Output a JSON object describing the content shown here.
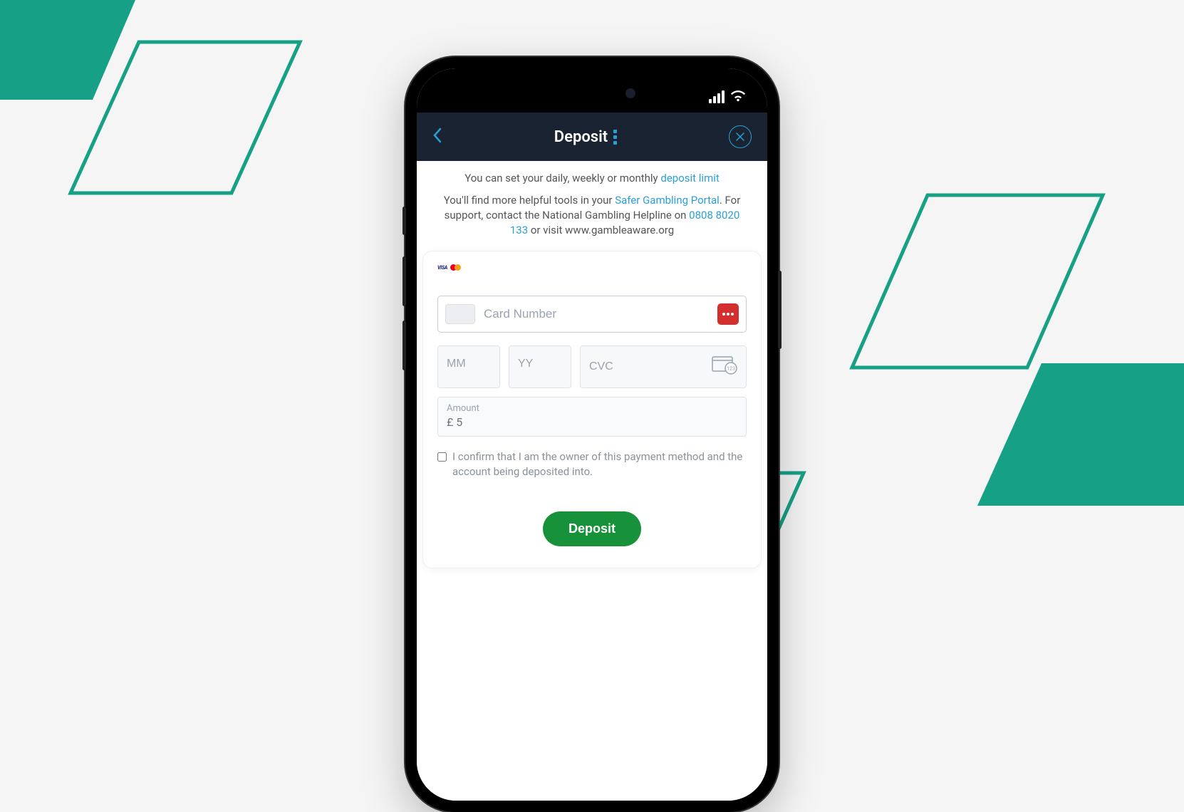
{
  "header": {
    "title": "Deposit"
  },
  "info": {
    "line1_pre": "You can set your daily, weekly or monthly ",
    "line1_link": "deposit limit",
    "line2_pre": "You'll find more helpful tools in your ",
    "line2_link1": "Safer Gambling Portal",
    "line2_mid": ". For support, contact the National Gambling Helpline on ",
    "line2_link2": "0808 8020 133",
    "line2_post": " or visit www.gambleaware.org"
  },
  "form": {
    "card_number_placeholder": "Card Number",
    "mm_placeholder": "MM",
    "yy_placeholder": "YY",
    "cvc_placeholder": "CVC",
    "amount_label": "Amount",
    "amount_value": "£ 5",
    "confirm_text": "I confirm that I am the owner of this payment method and the account being deposited into.",
    "deposit_button": "Deposit"
  },
  "colors": {
    "teal": "#16a085",
    "link": "#2a9fd6",
    "green": "#17913a",
    "header_bg": "#1a2332"
  }
}
